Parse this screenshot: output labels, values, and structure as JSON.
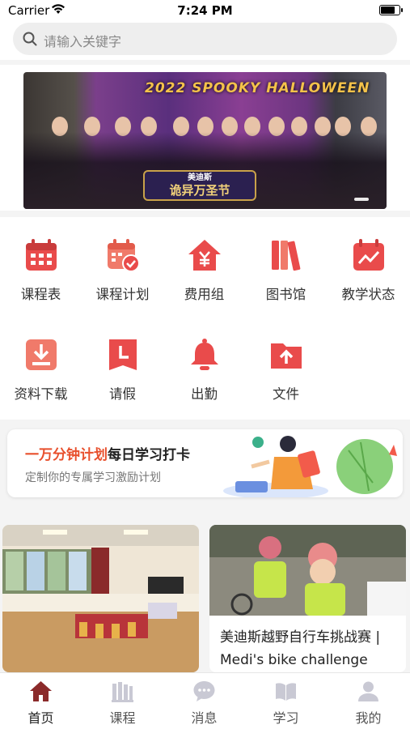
{
  "status_bar": {
    "carrier": "Carrier",
    "time": "7:24 PM"
  },
  "search": {
    "placeholder": "请输入关键字"
  },
  "banner": {
    "title": "2022 SPOOKY HALLOWEEN",
    "plaque_small": "美迪斯",
    "plaque": "诡异万圣节"
  },
  "menu": [
    {
      "label": "课程表",
      "icon": "calendar-grid-icon"
    },
    {
      "label": "课程计划",
      "icon": "calendar-check-icon"
    },
    {
      "label": "费用组",
      "icon": "yuan-house-icon"
    },
    {
      "label": "图书馆",
      "icon": "books-icon"
    },
    {
      "label": "教学状态",
      "icon": "calendar-trend-icon"
    },
    {
      "label": "资料下载",
      "icon": "download-icon"
    },
    {
      "label": "请假",
      "icon": "clock-bookmark-icon"
    },
    {
      "label": "出勤",
      "icon": "bell-icon"
    },
    {
      "label": "文件",
      "icon": "folder-upload-icon"
    }
  ],
  "promo": {
    "highlight": "一万分钟计划",
    "title_rest": "每日学习打卡",
    "subtitle": "定制你的专属学习激励计划"
  },
  "cards": [
    {
      "caption": ""
    },
    {
      "caption": "美迪斯越野自行车挑战赛 | Medi's bike challenge"
    }
  ],
  "tabs": [
    {
      "label": "首页",
      "icon": "home-icon",
      "active": true
    },
    {
      "label": "课程",
      "icon": "course-icon"
    },
    {
      "label": "消息",
      "icon": "message-icon"
    },
    {
      "label": "学习",
      "icon": "book-icon"
    },
    {
      "label": "我的",
      "icon": "user-icon"
    }
  ],
  "colors": {
    "accent": "#e94b4b",
    "active_tab": "#8b2a2a",
    "inactive_tab": "#c9c9d4"
  }
}
